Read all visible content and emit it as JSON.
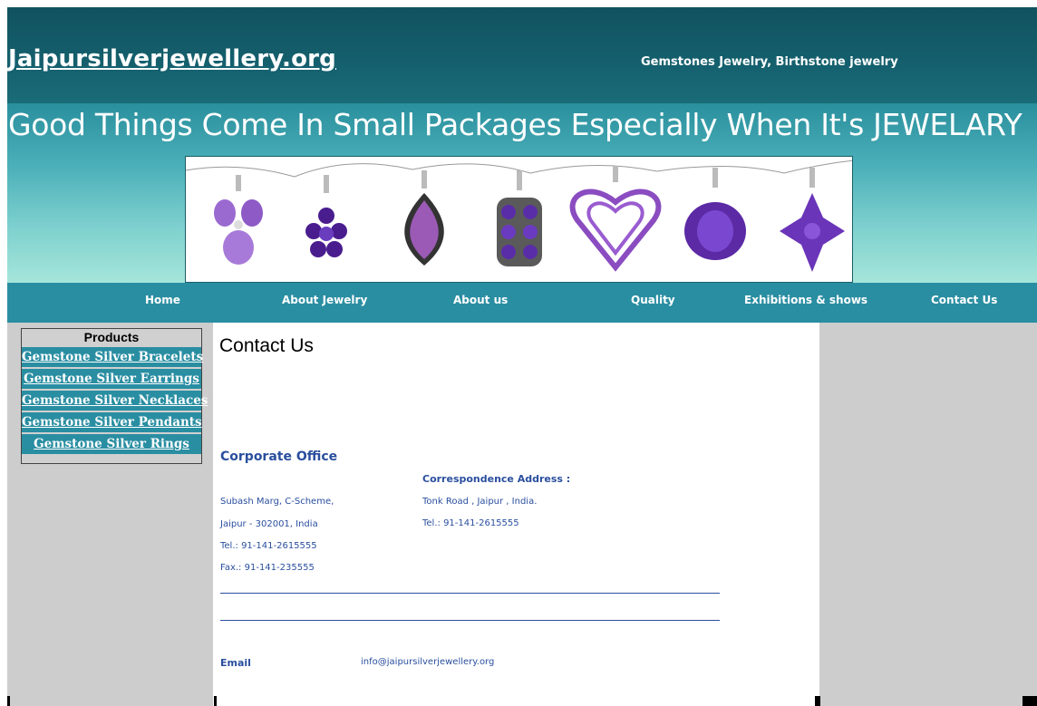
{
  "header": {
    "site_title": "Jaipursilverjewellery.org",
    "tagline": "Gemstones Jewelry, Birthstone jewelry",
    "slogan": "Good Things Come In Small Packages Especially When It's JEWELARY"
  },
  "nav": {
    "items": [
      "Home",
      "About Jewelry",
      "About us",
      "Quality",
      "Exhibitions & shows",
      "Contact Us"
    ]
  },
  "sidebar": {
    "title": "Products",
    "links": [
      "Gemstone Silver Bracelets",
      "Gemstone Silver Earrings",
      "Gemstone Silver Necklaces",
      "Gemstone Silver Pendants",
      " Gemstone Silver Rings"
    ]
  },
  "main": {
    "page_title": "Contact Us",
    "corporate_heading": "Corporate Office",
    "corporate_address": [
      "Subash Marg, C-Scheme,",
      "Jaipur - 302001, India",
      " Tel.: 91-141-2615555",
      " Fax.: 91-141-235555"
    ],
    "correspondence_heading": "Correspondence Address :",
    "correspondence_address": [
      "Tonk Road , Jaipur , India.",
      "Tel.: 91-141-2615555"
    ],
    "email_label": "Email",
    "email_value": "info@jaipursilverjewellery.org"
  },
  "colors": {
    "header_dark": "#11525f",
    "nav": "#2a8ea2",
    "link_text": "#2a4f9e",
    "gem_purple": "#6a2fb0"
  }
}
